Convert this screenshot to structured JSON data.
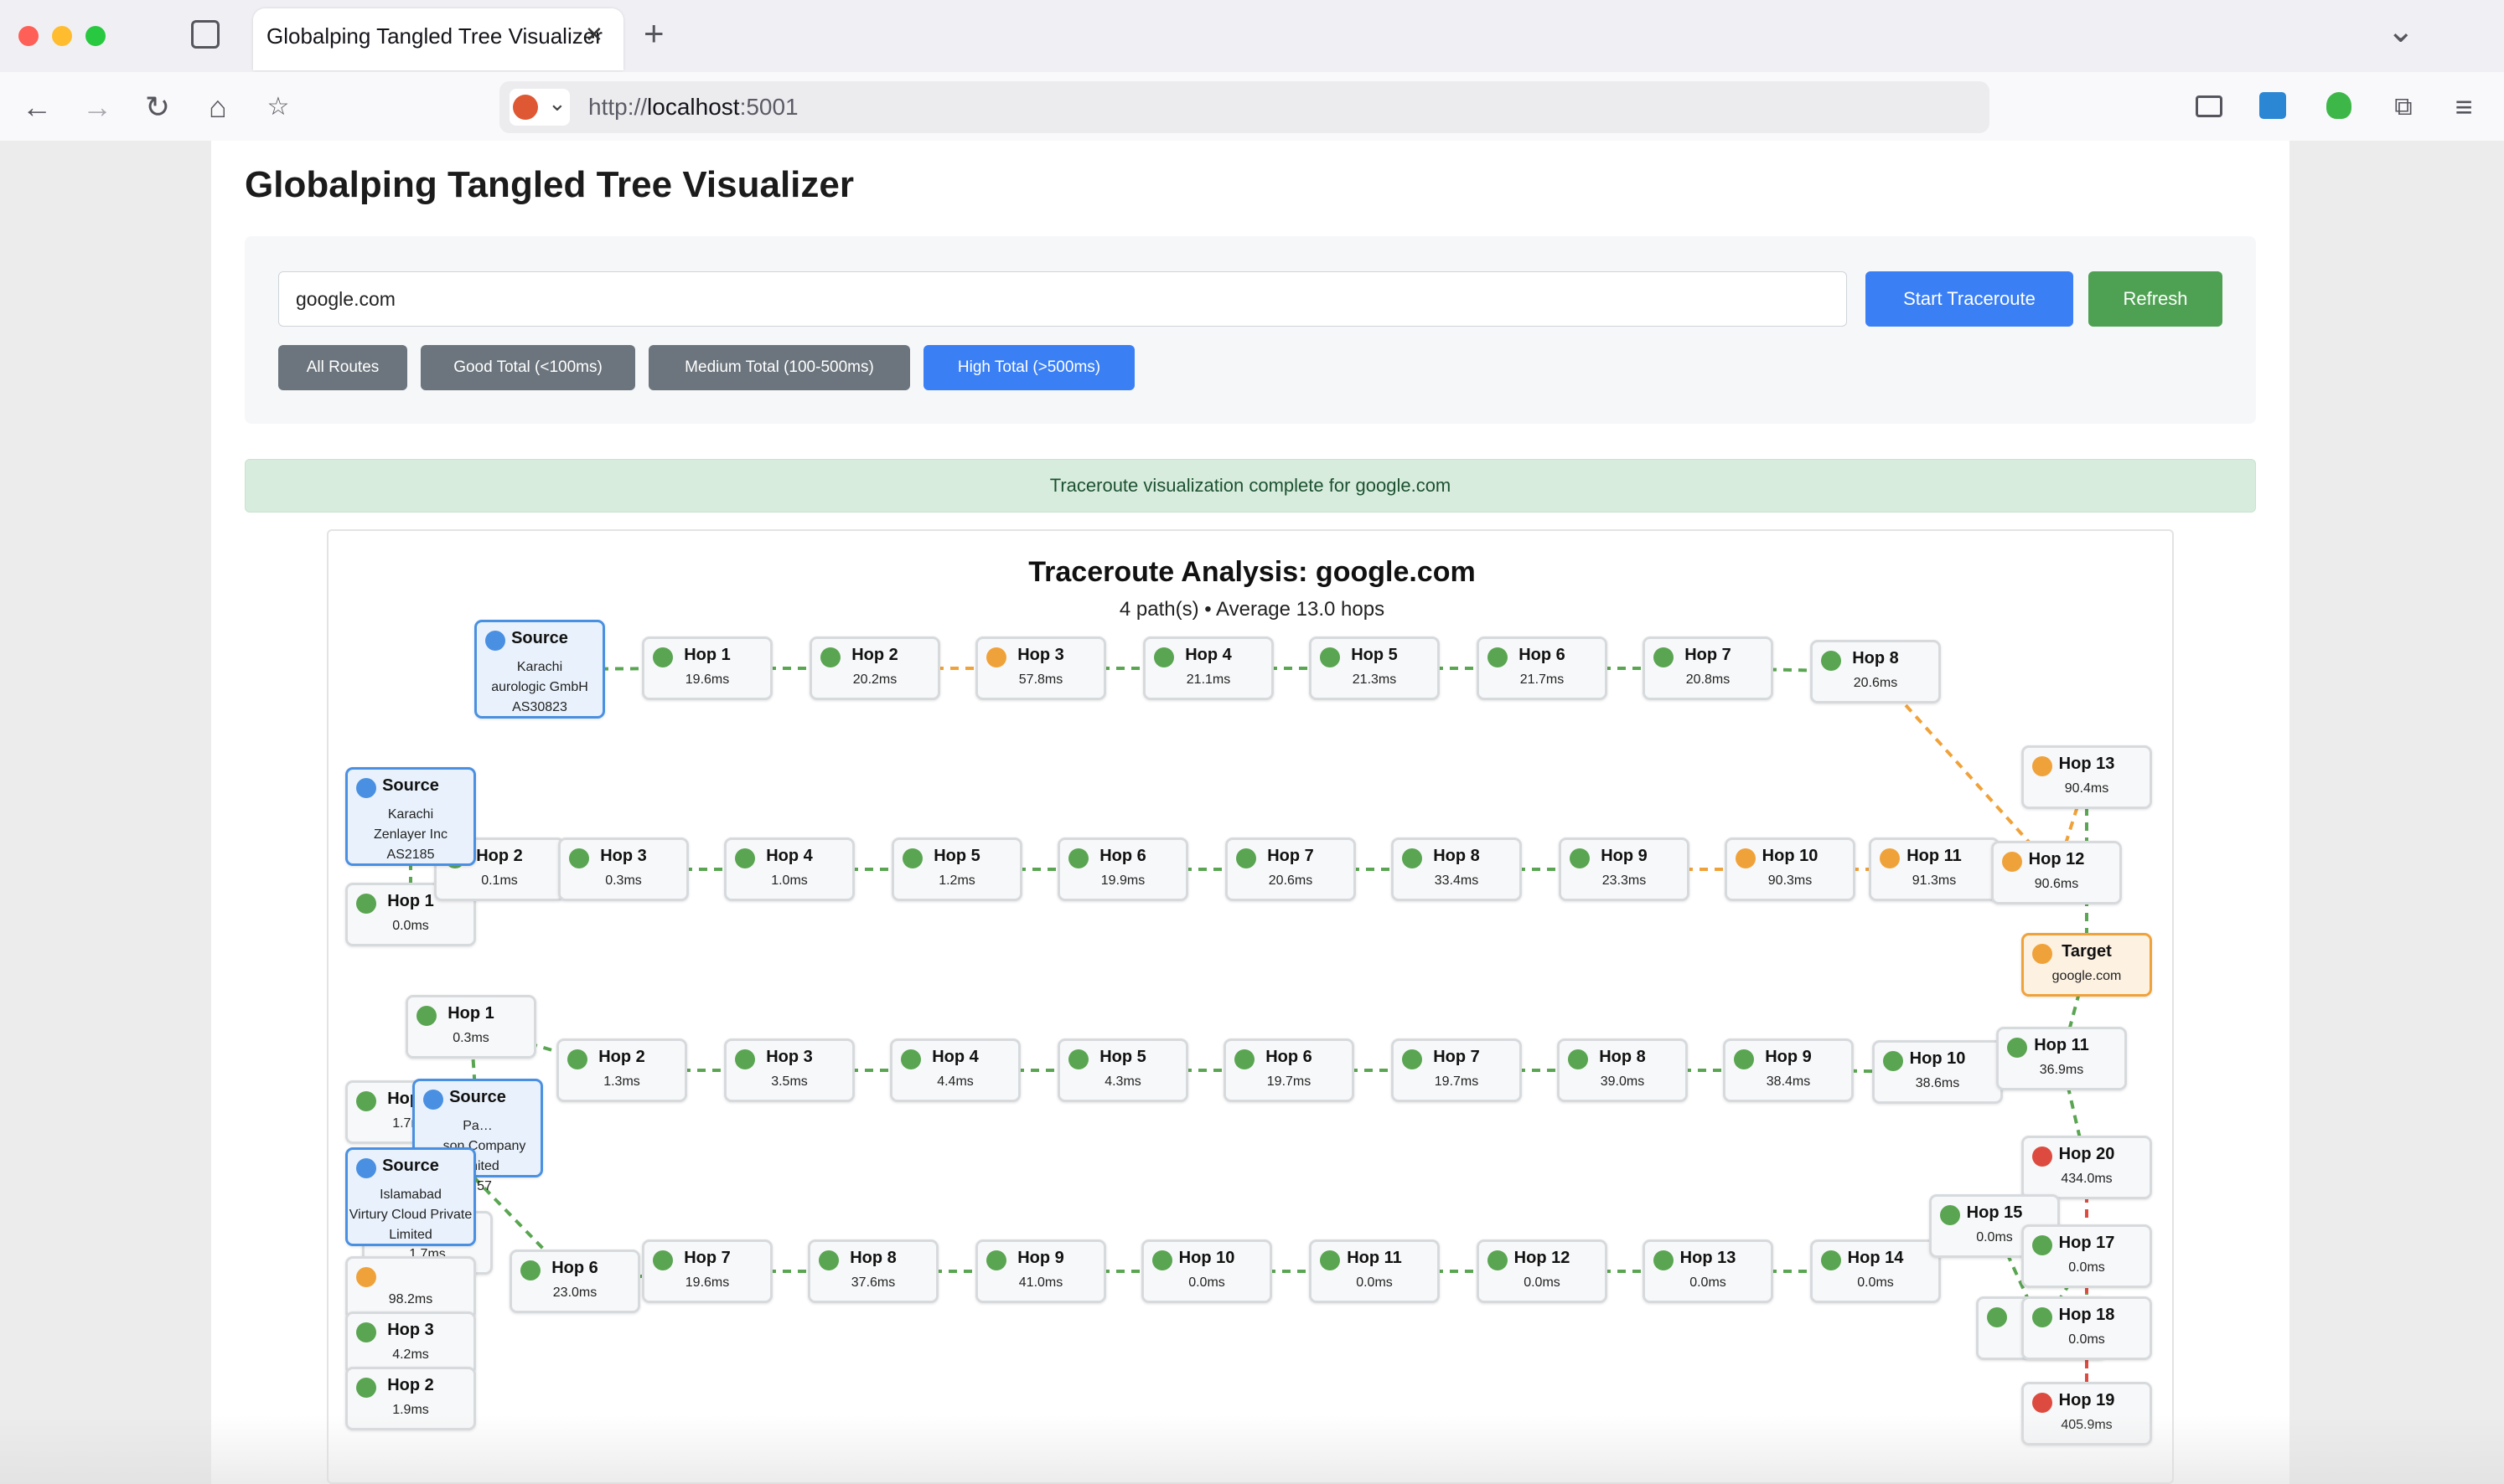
{
  "browser": {
    "tab_title": "Globalping Tangled Tree Visualizer",
    "tab_close": "✕",
    "new_tab": "+",
    "tabs_menu": "⌄",
    "url_scheme": "http://",
    "url_host": "localhost",
    "url_port": ":5001"
  },
  "page": {
    "title": "Globalping Tangled Tree Visualizer",
    "input_value": "google.com",
    "start_button": "Start Traceroute",
    "refresh_button": "Refresh",
    "filters": [
      "All Routes",
      "Good Total (<100ms)",
      "Medium Total (100-500ms)",
      "High Total (>500ms)"
    ],
    "active_filter": "High Total (>500ms)",
    "status": "Traceroute visualization complete for google.com"
  },
  "colors": {
    "good": "#5aa552",
    "medium": "#f0a23a",
    "high": "#dd4b40",
    "source": "#4a90e2",
    "primary_button": "#3a7ff4",
    "refresh_button": "#4ea152",
    "filter_button": "#6c757d"
  },
  "viz": {
    "title": "Traceroute Analysis: google.com",
    "subtitle": "4 path(s) • Average 13.0 hops",
    "sources": [
      {
        "id": "s1",
        "label": "Source",
        "lines": [
          "Karachi",
          "aurologic GmbH",
          "AS30823"
        ]
      },
      {
        "id": "s2",
        "label": "Source",
        "lines": [
          "Karachi",
          "Zenlayer Inc",
          "AS2185"
        ]
      },
      {
        "id": "s3",
        "label": "Source",
        "lines": [
          "Pa…",
          "…son Company Limited",
          "…57"
        ]
      },
      {
        "id": "s4",
        "label": "Source",
        "lines": [
          "Islamabad",
          "Virtury Cloud Private Limited"
        ]
      }
    ],
    "target": {
      "id": "t",
      "label": "Target",
      "value": "google.com"
    },
    "hops": [
      {
        "id": "p1h1",
        "label": "Hop 1",
        "value": "19.6ms",
        "status": "good"
      },
      {
        "id": "p1h2",
        "label": "Hop 2",
        "value": "20.2ms",
        "status": "good"
      },
      {
        "id": "p1h3",
        "label": "Hop 3",
        "value": "57.8ms",
        "status": "medium"
      },
      {
        "id": "p1h4",
        "label": "Hop 4",
        "value": "21.1ms",
        "status": "good"
      },
      {
        "id": "p1h5",
        "label": "Hop 5",
        "value": "21.3ms",
        "status": "good"
      },
      {
        "id": "p1h6",
        "label": "Hop 6",
        "value": "21.7ms",
        "status": "good"
      },
      {
        "id": "p1h7",
        "label": "Hop 7",
        "value": "20.8ms",
        "status": "good"
      },
      {
        "id": "p1h8",
        "label": "Hop 8",
        "value": "20.6ms",
        "status": "good"
      },
      {
        "id": "p2h13",
        "label": "Hop 13",
        "value": "90.4ms",
        "status": "medium"
      },
      {
        "id": "p2h1",
        "label": "Hop 1",
        "value": "0.0ms",
        "status": "good"
      },
      {
        "id": "p2h2",
        "label": "Hop 2",
        "value": "0.1ms",
        "status": "good"
      },
      {
        "id": "p2h3",
        "label": "Hop 3",
        "value": "0.3ms",
        "status": "good"
      },
      {
        "id": "p2h4",
        "label": "Hop 4",
        "value": "1.0ms",
        "status": "good"
      },
      {
        "id": "p2h5",
        "label": "Hop 5",
        "value": "1.2ms",
        "status": "good"
      },
      {
        "id": "p2h6",
        "label": "Hop 6",
        "value": "19.9ms",
        "status": "good"
      },
      {
        "id": "p2h7",
        "label": "Hop 7",
        "value": "20.6ms",
        "status": "good"
      },
      {
        "id": "p2h8",
        "label": "Hop 8",
        "value": "33.4ms",
        "status": "good"
      },
      {
        "id": "p2h9",
        "label": "Hop 9",
        "value": "23.3ms",
        "status": "good"
      },
      {
        "id": "p2h10",
        "label": "Hop 10",
        "value": "90.3ms",
        "status": "medium"
      },
      {
        "id": "p2h11",
        "label": "Hop 11",
        "value": "91.3ms",
        "status": "medium"
      },
      {
        "id": "p2h12",
        "label": "Hop 12",
        "value": "90.6ms",
        "status": "medium"
      },
      {
        "id": "p3h1",
        "label": "Hop 1",
        "value": "0.3ms",
        "status": "good"
      },
      {
        "id": "p3h2",
        "label": "Hop 2",
        "value": "1.3ms",
        "status": "good"
      },
      {
        "id": "p3h3",
        "label": "Hop 3",
        "value": "3.5ms",
        "status": "good"
      },
      {
        "id": "p3h4",
        "label": "Hop 4",
        "value": "4.4ms",
        "status": "good"
      },
      {
        "id": "p3h5",
        "label": "Hop 5",
        "value": "4.3ms",
        "status": "good"
      },
      {
        "id": "p3h6",
        "label": "Hop 6",
        "value": "19.7ms",
        "status": "good"
      },
      {
        "id": "p3h7",
        "label": "Hop 7",
        "value": "19.7ms",
        "status": "good"
      },
      {
        "id": "p3h8",
        "label": "Hop 8",
        "value": "39.0ms",
        "status": "good"
      },
      {
        "id": "p3h9",
        "label": "Hop 9",
        "value": "38.4ms",
        "status": "good"
      },
      {
        "id": "p3h10",
        "label": "Hop 10",
        "value": "38.6ms",
        "status": "good"
      },
      {
        "id": "p3h11",
        "label": "Hop 11",
        "value": "36.9ms",
        "status": "good"
      },
      {
        "id": "p4h20",
        "label": "Hop 20",
        "value": "434.0ms",
        "status": "high"
      },
      {
        "id": "p4h5",
        "label": "Hop 5",
        "value": "1.7ms",
        "status": "good"
      },
      {
        "id": "p4h4",
        "label": "Hop 4",
        "value": "1.7ms",
        "status": "good"
      },
      {
        "id": "p4hx",
        "label": "",
        "value": "98.2ms",
        "status": "medium"
      },
      {
        "id": "p4h3",
        "label": "Hop 3",
        "value": "4.2ms",
        "status": "good"
      },
      {
        "id": "p4h2",
        "label": "Hop 2",
        "value": "1.9ms",
        "status": "good"
      },
      {
        "id": "p4h6",
        "label": "Hop 6",
        "value": "23.0ms",
        "status": "good"
      },
      {
        "id": "p4h7",
        "label": "Hop 7",
        "value": "19.6ms",
        "status": "good"
      },
      {
        "id": "p4h8",
        "label": "Hop 8",
        "value": "37.6ms",
        "status": "good"
      },
      {
        "id": "p4h9",
        "label": "Hop 9",
        "value": "41.0ms",
        "status": "good"
      },
      {
        "id": "p4h10",
        "label": "Hop 10",
        "value": "0.0ms",
        "status": "good"
      },
      {
        "id": "p4h11",
        "label": "Hop 11",
        "value": "0.0ms",
        "status": "good"
      },
      {
        "id": "p4h12",
        "label": "Hop 12",
        "value": "0.0ms",
        "status": "good"
      },
      {
        "id": "p4h13",
        "label": "Hop 13",
        "value": "0.0ms",
        "status": "good"
      },
      {
        "id": "p4h14",
        "label": "Hop 14",
        "value": "0.0ms",
        "status": "good"
      },
      {
        "id": "p4h15",
        "label": "Hop 15",
        "value": "0.0ms",
        "status": "good"
      },
      {
        "id": "p4h16",
        "label": "H",
        "value": "",
        "status": "good"
      },
      {
        "id": "p4h17",
        "label": "Hop 17",
        "value": "0.0ms",
        "status": "good"
      },
      {
        "id": "p4h18",
        "label": "Hop 18",
        "value": "0.0ms",
        "status": "good"
      },
      {
        "id": "p4h19",
        "label": "Hop 19",
        "value": "405.9ms",
        "status": "high"
      }
    ]
  }
}
